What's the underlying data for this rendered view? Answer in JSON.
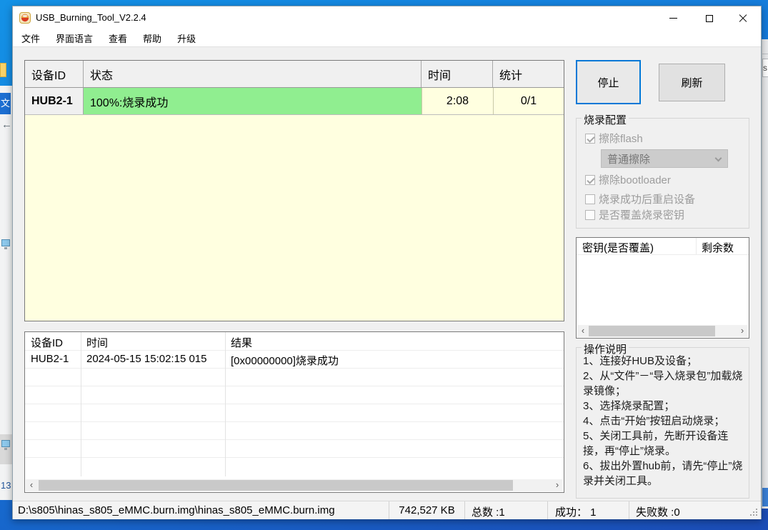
{
  "window": {
    "title": "USB_Burning_Tool_V2.2.4"
  },
  "menu": {
    "items": [
      "文件",
      "界面语言",
      "查看",
      "帮助",
      "升级"
    ]
  },
  "device_table": {
    "headers": {
      "id": "设备ID",
      "status": "状态",
      "time": "时间",
      "stat": "统计"
    },
    "row": {
      "id": "HUB2-1",
      "status": "100%:烧录成功",
      "time": "2:08",
      "stat": "0/1"
    }
  },
  "buttons": {
    "stop": "停止",
    "refresh": "刷新"
  },
  "burn_config": {
    "title": "烧录配置",
    "options": [
      {
        "label": "擦除flash",
        "checked": true
      },
      {
        "label": "擦除bootloader",
        "checked": true
      },
      {
        "label": "烧录成功后重启设备",
        "checked": false
      },
      {
        "label": "是否覆盖烧录密钥",
        "checked": false
      }
    ],
    "erase_mode": "普通擦除"
  },
  "key_table": {
    "col_key": "密钥(是否覆盖)",
    "col_remaining": "剩余数"
  },
  "instructions": {
    "title": "操作说明",
    "steps": [
      "1、连接好HUB及设备；",
      "2、从“文件”－“导入烧录包”加载烧录镜像；",
      "3、选择烧录配置；",
      "4、点击“开始”按钮启动烧录；",
      "5、关闭工具前，先断开设备连接，再“停止”烧录。",
      "6、拔出外置hub前，请先“停止”烧录并关闭工具。"
    ]
  },
  "log_table": {
    "headers": {
      "id": "设备ID",
      "time": "时间",
      "result": "结果"
    },
    "rows": [
      {
        "id": "HUB2-1",
        "time": "2024-05-15 15:02:15 015",
        "result": "[0x00000000]烧录成功"
      }
    ]
  },
  "status_bar": {
    "path": "D:\\s805\\hinas_s805_eMMC.burn.img\\hinas_s805_eMMC.burn.img",
    "size": "742,527 KB",
    "total": "总数 :1",
    "success": "成功： 1",
    "failed": "失败数 :0"
  },
  "background": {
    "left_number": "13",
    "right_letter": "s",
    "explorer_tile": "文"
  },
  "icons": {
    "scroll_left": "‹",
    "scroll_right": "›",
    "back_arrow": "←"
  },
  "colors": {
    "accent": "#0078d7",
    "success_green": "#90ee90",
    "pending_yellow": "#ffffe0"
  }
}
